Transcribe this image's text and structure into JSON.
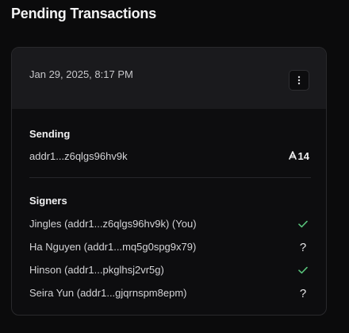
{
  "page": {
    "title": "Pending Transactions"
  },
  "transaction": {
    "timestamp": "Jan 29, 2025, 8:17 PM",
    "menu_icon": "more-vertical-icon",
    "sending": {
      "section_title": "Sending",
      "address": "addr1...z6qlgs96hv9k",
      "amount": "14",
      "currency_icon": "ada-icon"
    },
    "signers_section": {
      "section_title": "Signers",
      "items": [
        {
          "label": "Jingles (addr1...z6qlgs96hv9k) (You)",
          "status": "signed",
          "status_icon": "check-icon"
        },
        {
          "label": "Ha Nguyen (addr1...mq5g0spg9x79)",
          "status": "pending",
          "status_icon": "question-mark-icon"
        },
        {
          "label": "Hinson (addr1...pkglhsj2vr5g)",
          "status": "signed",
          "status_icon": "check-icon"
        },
        {
          "label": "Seira Yun (addr1...gjqrnspm8epm)",
          "status": "pending",
          "status_icon": "question-mark-icon"
        }
      ]
    }
  },
  "colors": {
    "background": "#0b0b0c",
    "card_header": "#1a1a1d",
    "success": "#59c37b",
    "text_primary": "#f1f1f2",
    "text_secondary": "#c7c7ca"
  }
}
